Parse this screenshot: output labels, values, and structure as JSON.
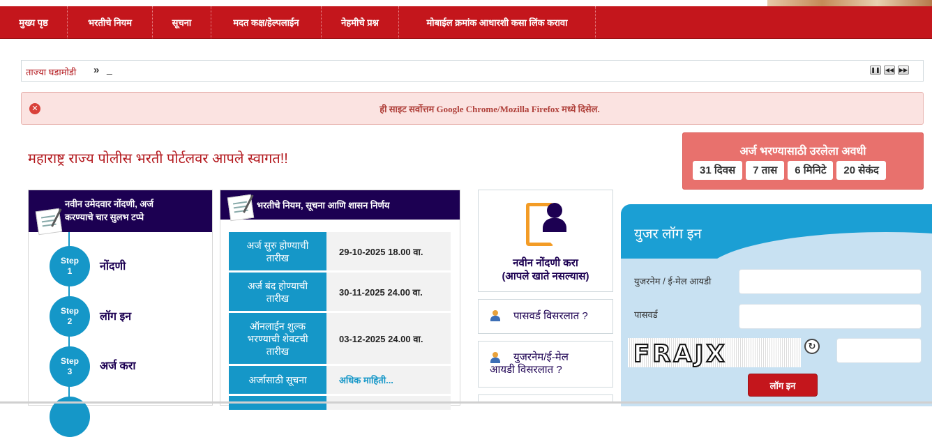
{
  "nav": {
    "items": [
      {
        "label": "मुख्य पृष्ठ"
      },
      {
        "label": "भरतीचे नियम"
      },
      {
        "label": "सूचना"
      },
      {
        "label": "मदत कक्ष/हेल्पलाईन"
      },
      {
        "label": "नेहमीचे प्रश्न"
      },
      {
        "label": "मोबाईल क्रमांक आधारशी कसा लिंक करावा"
      }
    ]
  },
  "ticker": {
    "label": "ताज्या घडामोडी",
    "arrows": "»",
    "cursor": "_"
  },
  "alert": {
    "message": "ही साइट सर्वोत्तम Google Chrome/Mozilla Firefox मध्ये दिसेल."
  },
  "welcome": "महाराष्ट्र राज्य पोलीस भरती पोर्टलवर आपले स्वागत!!",
  "timer": {
    "title": "अर्ज भरण्यासाठी उरलेला अवधी",
    "days": "31 दिवस",
    "hours": "7 तास",
    "minutes": "6 मिनिटे",
    "seconds": "20 सेकंद"
  },
  "steps_panel": {
    "title_line1": "नवीन उमेदवार नोंदणी, अर्ज",
    "title_line2": "करण्याचे चार सुलभ टप्पे",
    "steps": [
      {
        "badge": "Step",
        "num": "1",
        "label": "नोंदणी"
      },
      {
        "badge": "Step",
        "num": "2",
        "label": "लॉग इन"
      },
      {
        "badge": "Step",
        "num": "3",
        "label": "अर्ज करा"
      }
    ]
  },
  "rules_panel": {
    "title": "भरतीचे नियम, सूचना आणि शासन निर्णय",
    "rows": [
      {
        "key": "अर्ज सुरु होण्याची तारीख",
        "value": "29-10-2025 18.00 वा."
      },
      {
        "key": "अर्ज बंद होण्याची तारीख",
        "value": "30-11-2025 24.00 वा."
      },
      {
        "key": "ऑनलाईन शुल्क भरण्याची शेवटची तारीख",
        "value": "03-12-2025 24.00 वा."
      },
      {
        "key": "अर्जासाठी सूचना",
        "value": "अधिक माहिती..."
      }
    ]
  },
  "register": {
    "line1": "नवीन नोंदणी करा",
    "line2": "(आपले खाते नसल्यास)",
    "icon": "user-document-icon"
  },
  "links": {
    "forgot_password": "पासवर्ड विसरलात ?",
    "forgot_username_1": "युजरनेम/ई-मेल",
    "forgot_username_2": "आयडी विसरलात ?",
    "icon": "user-key-icon"
  },
  "login": {
    "title": "युजर लॉग इन",
    "username_label": "युजरनेम / ई-मेल आयडी",
    "password_label": "पासवर्ड",
    "captcha_text": "FRAJX",
    "button": "लॉग इन"
  },
  "colors": {
    "brand_red": "#c4161c",
    "navy": "#1c0052",
    "accent_blue": "#1597c8",
    "timer_bg": "#e8716d"
  }
}
